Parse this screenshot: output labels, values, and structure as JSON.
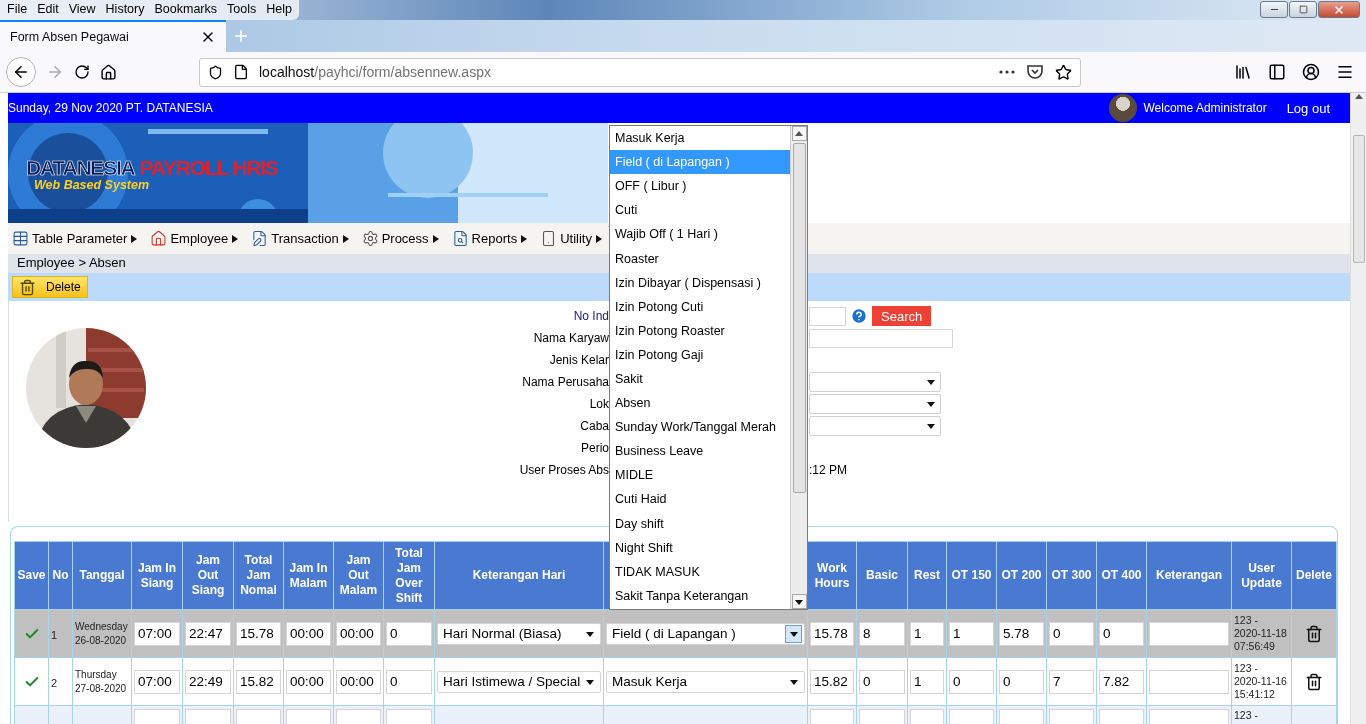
{
  "browser": {
    "menu": [
      "File",
      "Edit",
      "View",
      "History",
      "Bookmarks",
      "Tools",
      "Help"
    ],
    "tab": {
      "title": "Form Absen Pegawai"
    },
    "url": {
      "host": "localhost",
      "path": "/payhci/form/absennew.aspx"
    }
  },
  "header": {
    "date_company": "Sunday, 29 Nov 2020 PT. DATANESIA",
    "welcome": "Welcome Administrator",
    "logout": "Log out"
  },
  "logo": {
    "name": "DATANESIA",
    "product": "PAYROLL HRIS",
    "tagline": "Web Based System"
  },
  "menu": [
    {
      "label": "Table Parameter",
      "kind": "table"
    },
    {
      "label": "Employee",
      "kind": "house"
    },
    {
      "label": "Transaction",
      "kind": "pencil"
    },
    {
      "label": "Process",
      "kind": "gear"
    },
    {
      "label": "Reports",
      "kind": "search"
    },
    {
      "label": "Utility",
      "kind": "device"
    }
  ],
  "breadcrumb": "Employee > Absen",
  "toolbar": {
    "delete": "Delete"
  },
  "form": {
    "search_button": "Search",
    "fields": [
      {
        "label": "No Ind",
        "kind": "search"
      },
      {
        "label": "Nama Karyaw",
        "kind": "input"
      },
      {
        "label": "Jenis Kelar",
        "kind": "none"
      },
      {
        "label": "Nama Perusaha",
        "kind": "select"
      },
      {
        "label": "Lok",
        "kind": "select"
      },
      {
        "label": "Caba",
        "kind": "select"
      },
      {
        "label": "Perio",
        "kind": "none"
      },
      {
        "label": "User Proses Abs",
        "kind": "text",
        "value": ":12 PM"
      }
    ]
  },
  "table": {
    "columns": [
      {
        "label": "Save",
        "kind": "check"
      },
      {
        "label": "No",
        "kind": "text"
      },
      {
        "label": "Tanggal",
        "kind": "date"
      },
      {
        "label": "Jam In Siang",
        "kind": "input"
      },
      {
        "label": "Jam Out Siang",
        "kind": "input"
      },
      {
        "label": "Total Jam Nomal",
        "kind": "input"
      },
      {
        "label": "Jam In Malam",
        "kind": "input"
      },
      {
        "label": "Jam Out Malam",
        "kind": "input"
      },
      {
        "label": "Total Jam Over Shift",
        "kind": "input"
      },
      {
        "label": "Keterangan Hari",
        "kind": "select"
      },
      {
        "kind": "select2"
      },
      {
        "label": "Work Hours",
        "kind": "input"
      },
      {
        "label": "Basic",
        "kind": "input"
      },
      {
        "label": "Rest",
        "kind": "input"
      },
      {
        "label": "OT 150",
        "kind": "input"
      },
      {
        "label": "OT 200",
        "kind": "input"
      },
      {
        "label": "OT 300",
        "kind": "input"
      },
      {
        "label": "OT 400",
        "kind": "input"
      },
      {
        "label": "Keterangan",
        "kind": "input"
      },
      {
        "label": "User Update",
        "kind": "update"
      },
      {
        "label": "Delete",
        "kind": "delete"
      }
    ],
    "rows": [
      {
        "selected": true,
        "open_select": true,
        "cells": [
          null,
          "1",
          {
            "day": "Wednesday",
            "date": "26-08-2020"
          },
          "07:00",
          "22:47",
          "15.78",
          "00:00",
          "00:00",
          "0",
          "Hari Normal (Biasa)",
          "Field ( di Lapangan )",
          "15.78",
          "8",
          "1",
          "1",
          "5.78",
          "0",
          "0",
          null,
          [
            "123 -",
            "2020-11-18",
            "07:56:49"
          ],
          null
        ]
      },
      {
        "selected": false,
        "open_select": false,
        "cells": [
          null,
          "2",
          {
            "day": "Thursday",
            "date": "27-08-2020"
          },
          "07:00",
          "22:49",
          "15.82",
          "00:00",
          "00:00",
          "0",
          "Hari Istimewa / Special",
          "Masuk Kerja",
          "15.82",
          "0",
          "1",
          "0",
          "0",
          "7",
          "7.82",
          null,
          [
            "123 -",
            "2020-11-16",
            "15:41:12"
          ],
          null
        ]
      },
      {
        "selected": false,
        "cells": [
          null,
          null,
          null,
          null,
          null,
          null,
          null,
          null,
          null,
          null,
          null,
          null,
          null,
          null,
          null,
          null,
          null,
          null,
          null,
          [
            "123 -"
          ],
          null
        ]
      }
    ]
  },
  "dropdown": {
    "items": [
      {
        "label": "Masuk Kerja",
        "selected": false
      },
      {
        "label": "Field ( di Lapangan )",
        "selected": true
      },
      {
        "label": "OFF ( Libur )",
        "selected": false
      },
      {
        "label": "Cuti",
        "selected": false
      },
      {
        "label": "Wajib Off ( 1 Hari )",
        "selected": false
      },
      {
        "label": "Roaster",
        "selected": false
      },
      {
        "label": "Izin Dibayar ( Dispensasi )",
        "selected": false
      },
      {
        "label": "Izin Potong Cuti",
        "selected": false
      },
      {
        "label": "Izin Potong Roaster",
        "selected": false
      },
      {
        "label": "Izin Potong Gaji",
        "selected": false
      },
      {
        "label": "Sakit",
        "selected": false
      },
      {
        "label": "Absen",
        "selected": false
      },
      {
        "label": "Sunday Work/Tanggal Merah",
        "selected": false
      },
      {
        "label": "Business Leave",
        "selected": false
      },
      {
        "label": "MIDLE",
        "selected": false
      },
      {
        "label": "Cuti Haid",
        "selected": false
      },
      {
        "label": "Day shift",
        "selected": false
      },
      {
        "label": "Night Shift",
        "selected": false
      },
      {
        "label": "TIDAK MASUK",
        "selected": false
      },
      {
        "label": "Sakit Tanpa Keterangan",
        "selected": false
      }
    ]
  }
}
